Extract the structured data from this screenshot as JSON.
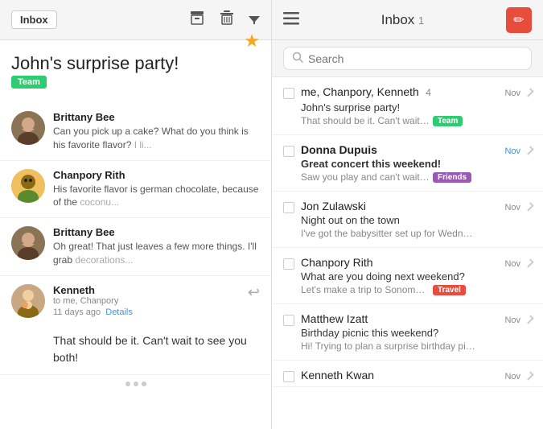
{
  "left": {
    "header": {
      "inbox_label": "Inbox",
      "archive_icon": "📥",
      "delete_icon": "🗑",
      "filter_icon": "▼"
    },
    "thread": {
      "title": "John's surprise party!",
      "tag": "Team",
      "messages": [
        {
          "sender": "Brittany Bee",
          "text": "Can you pick up a cake? What do you think is his favorite flavor?",
          "fade": " I li..."
        },
        {
          "sender": "Chanpory Rith",
          "text": "His favorite flavor is german chocolate, because of the",
          "fade": " coconu..."
        },
        {
          "sender": "Brittany Bee",
          "text": "Oh great! That just leaves a few more things. I'll grab",
          "fade": " decorations..."
        }
      ],
      "kenneth": {
        "sender": "Kenneth",
        "to": "to me, Chanpory",
        "date": "11 days ago",
        "details_label": "Details",
        "body": "That should be it. Can't wait to see you both!"
      }
    }
  },
  "right": {
    "header": {
      "title": "Inbox",
      "unread_count": "1",
      "compose_icon": "✏"
    },
    "search": {
      "placeholder": "Search"
    },
    "emails": [
      {
        "sender": "me, Chanpory, Kenneth",
        "count": "4",
        "date": "Nov",
        "subject": "John's surprise party!",
        "preview": "That should be it. Can't wait to see...",
        "tag": "Team",
        "tag_class": "tag-team",
        "unread": false
      },
      {
        "sender": "Donna Dupuis",
        "count": "",
        "date": "Nov",
        "subject": "Great concert this weekend!",
        "preview": "Saw you play and can't wait to se...",
        "tag": "Friends",
        "tag_class": "tag-friends",
        "unread": true
      },
      {
        "sender": "Jon Zulawski",
        "count": "",
        "date": "Nov",
        "subject": "Night out on the town",
        "preview": "I've got the babysitter set up for Wednesd...",
        "tag": "",
        "tag_class": "",
        "unread": false
      },
      {
        "sender": "Chanpory Rith",
        "count": "",
        "date": "Nov",
        "subject": "What are you doing next weekend?",
        "preview": "Let's make a trip to Sonoma? Call ...",
        "tag": "Travel",
        "tag_class": "tag-travel",
        "unread": false
      },
      {
        "sender": "Matthew Izatt",
        "count": "",
        "date": "Nov",
        "subject": "Birthday picnic this weekend?",
        "preview": "Hi! Trying to plan a surprise birthday picnic...",
        "tag": "",
        "tag_class": "",
        "unread": false
      },
      {
        "sender": "Kenneth Kwan",
        "count": "",
        "date": "Nov",
        "subject": "",
        "preview": "",
        "tag": "",
        "tag_class": "",
        "unread": false
      }
    ]
  }
}
